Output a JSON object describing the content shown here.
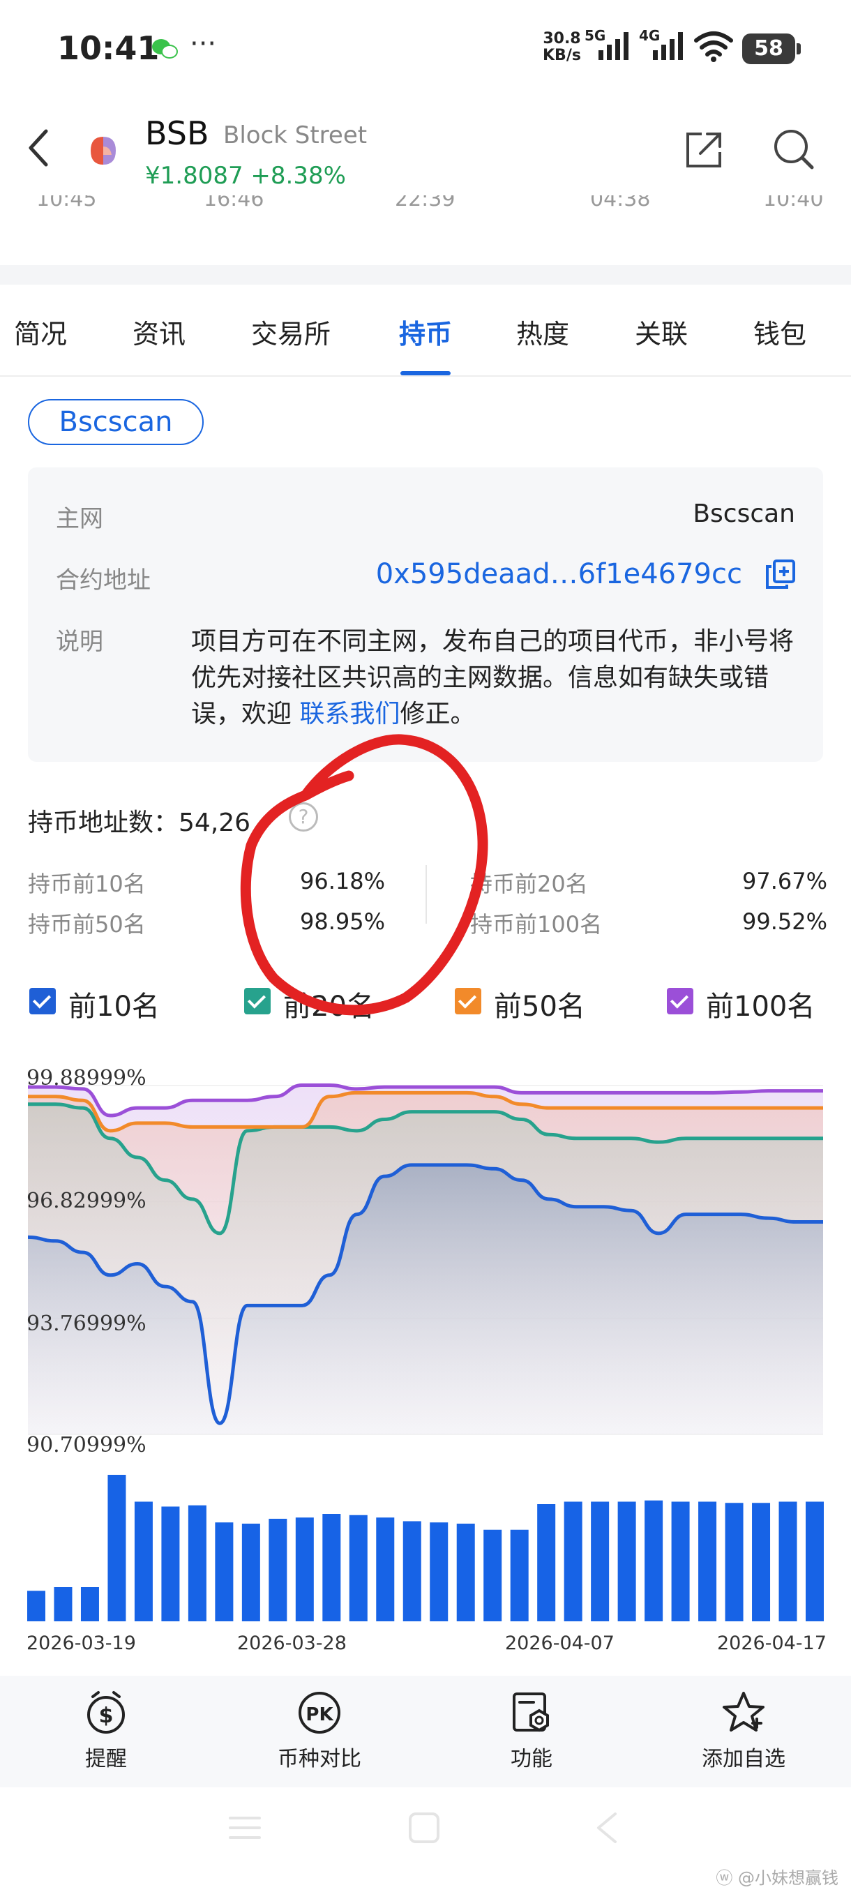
{
  "status_bar": {
    "time": "10:41",
    "dots": "···",
    "net_speed_value": "30.8",
    "net_speed_unit": "KB/s",
    "sig1_label": "5G",
    "sig2_label": "4G",
    "battery": "58"
  },
  "header": {
    "symbol": "BSB",
    "name": "Block Street",
    "price": "¥1.8087 +8.38%"
  },
  "time_axis": [
    "10:45",
    "16:46",
    "22:39",
    "04:38",
    "10:40"
  ],
  "tabs": [
    {
      "label": "简况"
    },
    {
      "label": "资讯"
    },
    {
      "label": "交易所"
    },
    {
      "label": "持币",
      "active": true
    },
    {
      "label": "热度"
    },
    {
      "label": "关联"
    },
    {
      "label": "钱包"
    }
  ],
  "chip": "Bscscan",
  "info": {
    "mainnet_label": "主网",
    "mainnet_value": "Bscscan",
    "contract_label": "合约地址",
    "contract_value": "0x595deaad…6f1e4679cc",
    "desc_label": "说明",
    "desc_text": "项目方可在不同主网，发布自己的项目代币，非小号将优先对接社区共识高的主网数据。信息如有缺失或错误，欢迎 ",
    "desc_link": "联系我们",
    "desc_tail": "修正。"
  },
  "holders": {
    "label": "持币地址数：",
    "value": "54,26"
  },
  "stats": [
    {
      "label": "持币前10名",
      "value": "96.18%"
    },
    {
      "label": "持币前20名",
      "value": "97.67%"
    },
    {
      "label": "持币前50名",
      "value": "98.95%"
    },
    {
      "label": "持币前100名",
      "value": "99.52%"
    }
  ],
  "legend": [
    {
      "label": "前10名",
      "color": "#1f5fd6"
    },
    {
      "label": "前20名",
      "color": "#27a28d"
    },
    {
      "label": "前50名",
      "color": "#f28a2a"
    },
    {
      "label": "前100名",
      "color": "#9b4fd8"
    }
  ],
  "chart_data": {
    "type": "area",
    "y_tick_labels": [
      "99.88999%",
      "96.82999%",
      "93.76999%",
      "90.70999%"
    ],
    "x_tick_labels": [
      "2026-03-19",
      "2026-03-28",
      "2026-04-07",
      "2026-04-17"
    ],
    "ylim": [
      90.71,
      99.89
    ],
    "series": [
      {
        "name": "前10名",
        "color": "#1f5fd6",
        "values": [
          95.9,
          95.8,
          95.5,
          94.9,
          95.2,
          94.6,
          94.2,
          91.0,
          94.1,
          94.1,
          94.1,
          94.9,
          96.5,
          97.5,
          97.8,
          97.8,
          97.8,
          97.7,
          97.4,
          96.9,
          96.7,
          96.7,
          96.6,
          96.0,
          96.5,
          96.5,
          96.5,
          96.4,
          96.3,
          96.3
        ]
      },
      {
        "name": "前20名",
        "color": "#27a28d",
        "values": [
          99.4,
          99.4,
          99.3,
          98.5,
          98.0,
          97.4,
          96.9,
          96.0,
          98.7,
          98.8,
          98.8,
          98.8,
          98.7,
          99.0,
          99.2,
          99.2,
          99.2,
          99.2,
          99.0,
          98.6,
          98.5,
          98.5,
          98.5,
          98.4,
          98.5,
          98.5,
          98.5,
          98.5,
          98.5,
          98.5
        ]
      },
      {
        "name": "前50名",
        "color": "#f28a2a",
        "values": [
          99.6,
          99.6,
          99.5,
          98.7,
          98.9,
          98.9,
          98.8,
          98.8,
          98.8,
          98.8,
          98.8,
          99.6,
          99.7,
          99.7,
          99.7,
          99.7,
          99.7,
          99.6,
          99.4,
          99.3,
          99.3,
          99.3,
          99.3,
          99.3,
          99.3,
          99.3,
          99.3,
          99.3,
          99.3,
          99.3
        ]
      },
      {
        "name": "前100名",
        "color": "#9b4fd8",
        "values": [
          99.85,
          99.85,
          99.8,
          99.1,
          99.3,
          99.3,
          99.5,
          99.5,
          99.5,
          99.6,
          99.9,
          99.9,
          99.8,
          99.85,
          99.85,
          99.85,
          99.85,
          99.85,
          99.7,
          99.7,
          99.7,
          99.7,
          99.7,
          99.7,
          99.7,
          99.7,
          99.72,
          99.75,
          99.75,
          99.75
        ]
      }
    ],
    "bar_values": [
      25,
      28,
      28,
      120,
      98,
      94,
      95,
      81,
      80,
      84,
      85,
      88,
      87,
      85,
      82,
      81,
      80,
      75,
      75,
      96,
      98,
      98,
      98,
      99,
      98,
      98,
      97,
      97,
      98,
      98
    ]
  },
  "toolbar": [
    {
      "label": "提醒",
      "icon": "dollar-alarm-icon"
    },
    {
      "label": "币种对比",
      "icon": "pk-icon"
    },
    {
      "label": "功能",
      "icon": "function-icon"
    },
    {
      "label": "添加自选",
      "icon": "star-add-icon"
    }
  ],
  "watermark": "小妹想赢钱"
}
